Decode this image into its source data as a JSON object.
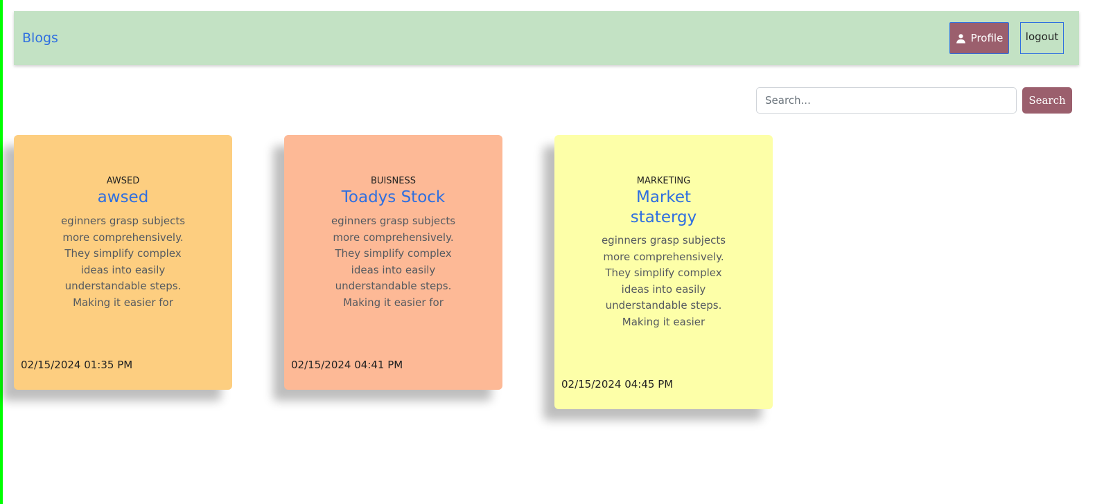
{
  "colors": {
    "left_edge": "#00ff00",
    "navbar_bg": "#c3e2c4",
    "brand_link": "#2f6fe0",
    "profile_button_bg": "#9b5f6d",
    "profile_button_border": "#2f6fe0",
    "logout_border": "#2f6fe0",
    "search_button_bg": "#9b5f6d",
    "title_link": "#2f6fe0"
  },
  "navbar": {
    "brand": "Blogs",
    "profile_label": "Profile",
    "profile_icon": "person-icon",
    "logout_label": "logout"
  },
  "search": {
    "placeholder": "Search...",
    "value": "",
    "button_label": "Search"
  },
  "posts": [
    {
      "category": "AWSED",
      "title": "awsed",
      "excerpt": "eginners grasp subjects more comprehensively. They simplify complex ideas into easily understandable steps. Making it easier for",
      "date": "02/15/2024 01:35 PM",
      "bg": "#fdce80"
    },
    {
      "category": "BUISNESS",
      "title": "Toadys Stock",
      "excerpt": "eginners grasp subjects more comprehensively. They simplify complex ideas into easily understandable steps. Making it easier for",
      "date": "02/15/2024 04:41 PM",
      "bg": "#fdb996"
    },
    {
      "category": "MARKETING",
      "title": "Market statergy",
      "excerpt": "eginners grasp subjects more comprehensively. They simplify complex ideas into easily understandable steps. Making it easier",
      "date": "02/15/2024 04:45 PM",
      "bg": "#fdffa8"
    }
  ]
}
